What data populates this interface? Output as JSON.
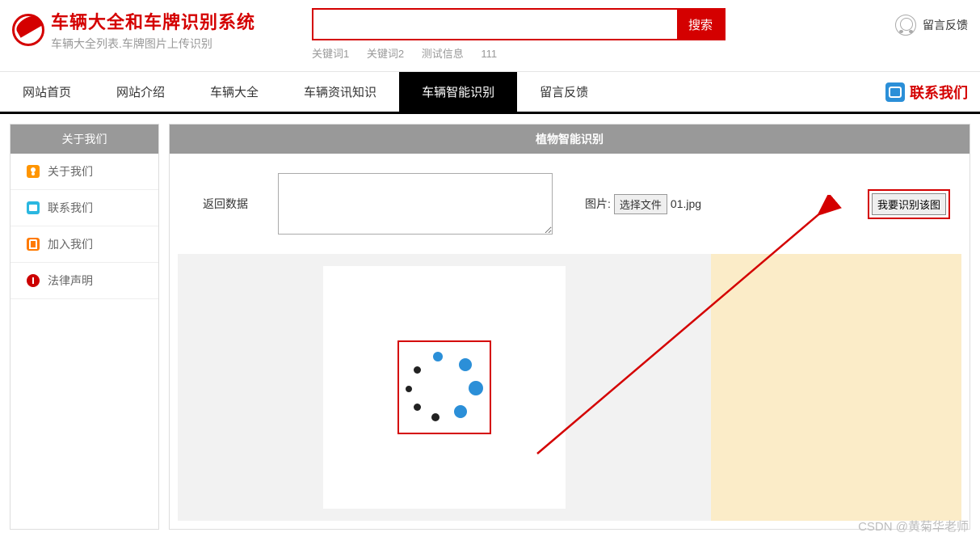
{
  "header": {
    "title": "车辆大全和车牌识别系统",
    "subtitle": "车辆大全列表.车牌图片上传识别",
    "search_placeholder": "",
    "search_button": "搜索",
    "keywords": [
      "关键词1",
      "关键词2",
      "测试信息",
      "111"
    ],
    "feedback": "留言反馈"
  },
  "nav": {
    "items": [
      "网站首页",
      "网站介绍",
      "车辆大全",
      "车辆资讯知识",
      "车辆智能识别",
      "留言反馈"
    ],
    "active_index": 4,
    "contact": "联系我们"
  },
  "sidebar": {
    "header": "关于我们",
    "items": [
      {
        "label": "关于我们",
        "icon": "about"
      },
      {
        "label": "联系我们",
        "icon": "contact"
      },
      {
        "label": "加入我们",
        "icon": "join"
      },
      {
        "label": "法律声明",
        "icon": "law"
      }
    ]
  },
  "main": {
    "header": "植物智能识别",
    "return_label": "返回数据",
    "textarea_value": "",
    "image_label": "图片:",
    "file_button": "选择文件",
    "file_name": "01.jpg",
    "recognize_button": "我要识别该图"
  },
  "watermark": "CSDN @黄菊华老师"
}
